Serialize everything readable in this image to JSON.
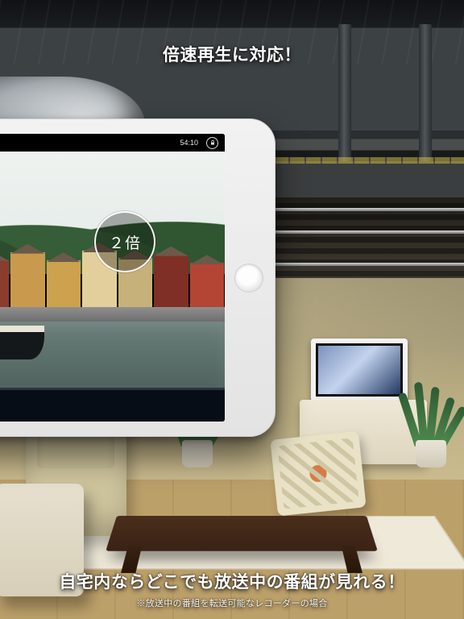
{
  "captions": {
    "top": "倍速再生に対応！",
    "bottom": "自宅内ならどこでも放送中の番組が見れる！",
    "note": "※放送中の番組を転送可能なレコーダーの場合"
  },
  "player": {
    "time_remaining": "54:10",
    "speed_label": "２倍",
    "icons": {
      "lock": "lock-icon",
      "pause": "pause-icon",
      "fast_forward": "fast-forward-icon"
    }
  }
}
